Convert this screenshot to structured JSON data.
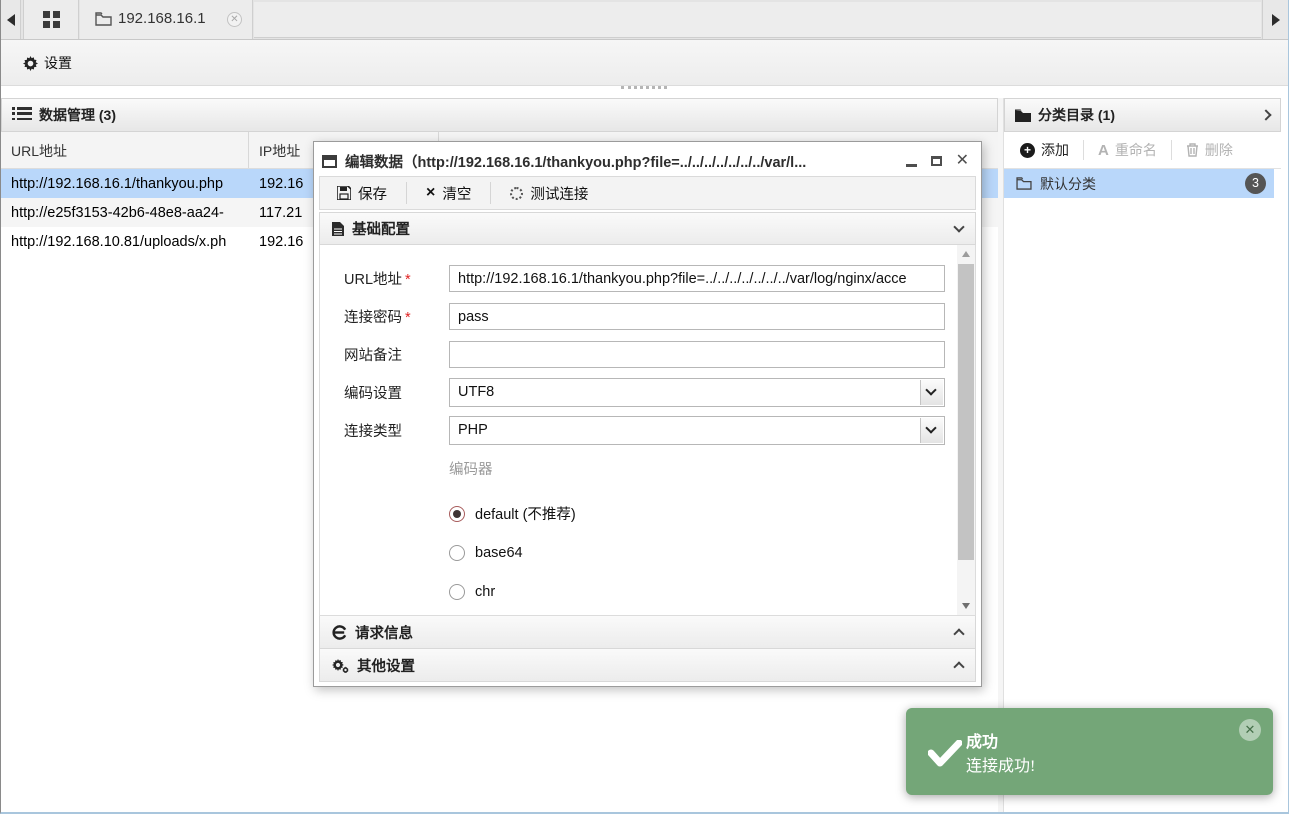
{
  "tabbar": {
    "site_tab_label": "192.168.16.1",
    "close_glyph": "✕"
  },
  "topbar": {
    "settings_label": "设置"
  },
  "left_panel": {
    "title": "数据管理 (3)",
    "columns": {
      "url": "URL地址",
      "ip": "IP地址"
    },
    "rows": [
      {
        "url": "http://192.168.16.1/thankyou.php",
        "ip": "192.16"
      },
      {
        "url": "http://e25f3153-42b6-48e8-aa24-",
        "ip": "117.21"
      },
      {
        "url": "http://192.168.10.81/uploads/x.ph",
        "ip": "192.16"
      }
    ]
  },
  "right_panel": {
    "title": "分类目录 (1)",
    "add_label": "添加",
    "rename_label": "重命名",
    "delete_label": "删除",
    "item": {
      "label": "默认分类",
      "badge": "3"
    }
  },
  "dialog": {
    "title": "编辑数据（http://192.168.16.1/thankyou.php?file=../../../../../../../var/l...",
    "toolbar": {
      "save": "保存",
      "clear": "清空",
      "test": "测试连接"
    },
    "sections": {
      "basic": "基础配置",
      "request": "请求信息",
      "other": "其他设置"
    },
    "form": {
      "req_mark": "*",
      "url_label": "URL地址",
      "url_value": "http://192.168.16.1/thankyou.php?file=../../../../../../../var/log/nginx/acce",
      "pwd_label": "连接密码",
      "pwd_value": "pass",
      "note_label": "网站备注",
      "note_value": "",
      "encoding_label": "编码设置",
      "encoding_value": "UTF8",
      "type_label": "连接类型",
      "type_value": "PHP",
      "encoder_label": "编码器",
      "encoders": [
        {
          "label": "default (不推荐)",
          "checked": true
        },
        {
          "label": "base64",
          "checked": false
        },
        {
          "label": "chr",
          "checked": false
        }
      ]
    },
    "controls": {
      "close": "✕"
    }
  },
  "toast": {
    "title": "成功",
    "message": "连接成功!",
    "close": "✕"
  },
  "colors": {
    "toast_green": "#74a678",
    "selected_blue": "#b9d7fa",
    "badge_gray": "#555555",
    "required_red": "#e02222"
  }
}
